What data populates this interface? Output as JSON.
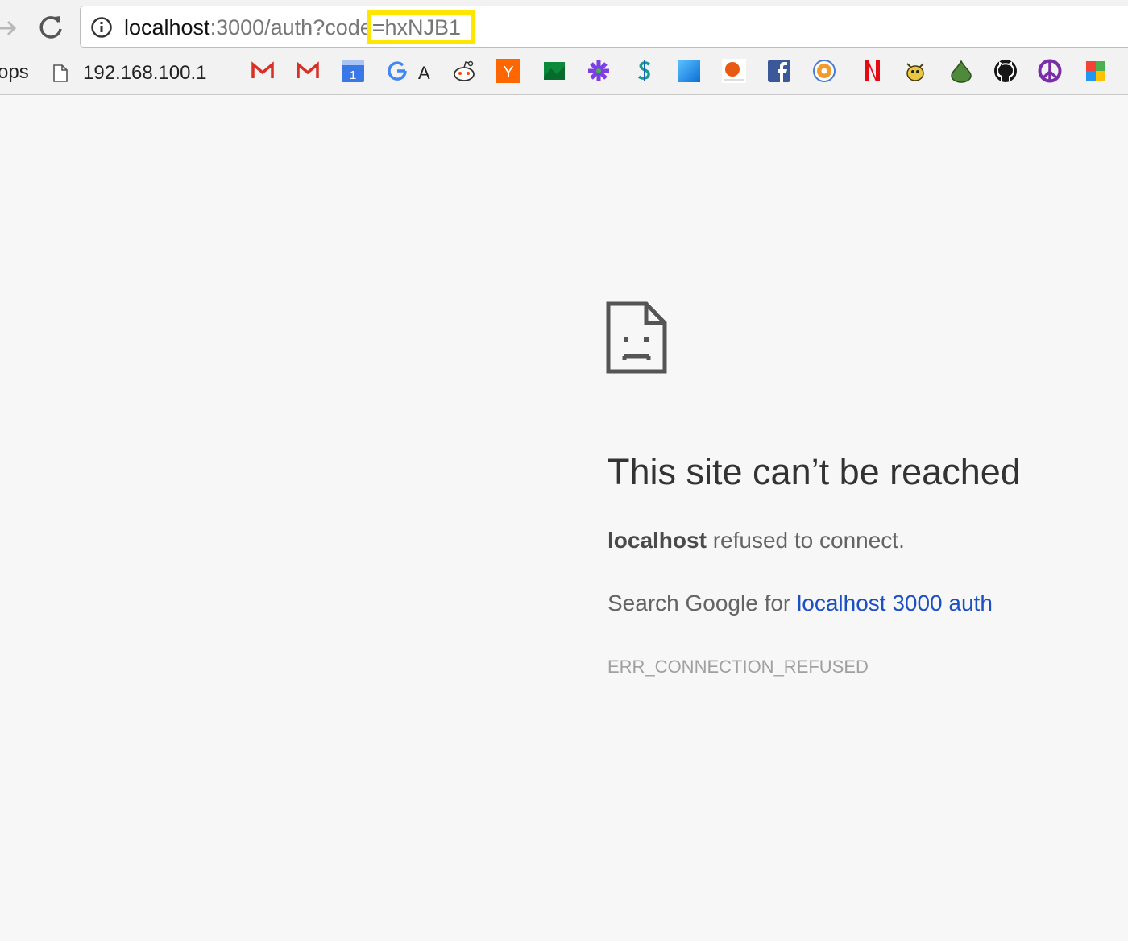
{
  "toolbar": {
    "url_host": "localhost",
    "url_rest": ":3000/auth?code",
    "url_highlight": "=hxNJB1"
  },
  "bookmarks": {
    "apps_label": "ops",
    "page_label": "192.168.100.1",
    "icons": [
      "gmail-icon",
      "gmail-icon",
      "google-calendar-icon",
      "google-translate-icon",
      "reddit-icon",
      "hacker-news-icon",
      "green-app-icon",
      "slack-icon",
      "dollar-icon",
      "blue-square-icon",
      "orange-ball-icon",
      "facebook-icon",
      "orange-circle-icon",
      "netflix-icon",
      "bug-icon",
      "green-drop-icon",
      "github-icon",
      "peace-icon",
      "colorful-icon"
    ],
    "calendar_day": "1",
    "hn_letter": "Y",
    "translate_letter": "A"
  },
  "error": {
    "title": "This site can’t be reached",
    "host": "localhost",
    "message": " refused to connect.",
    "search_prefix": "Search Google for ",
    "search_link": "localhost 3000 auth",
    "code": "ERR_CONNECTION_REFUSED"
  }
}
